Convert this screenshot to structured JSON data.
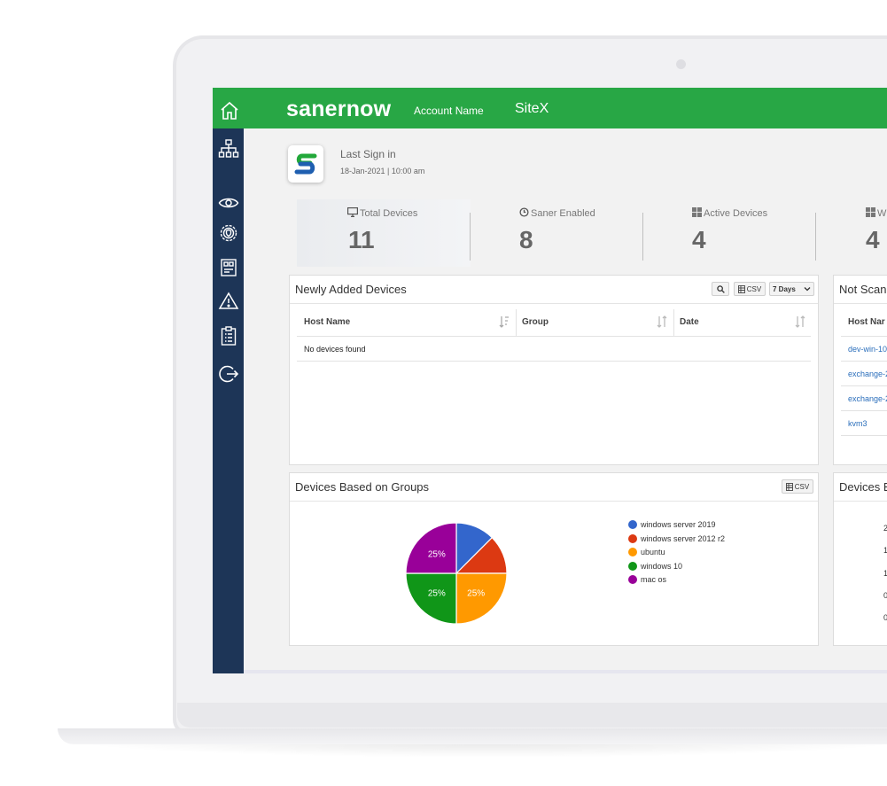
{
  "header": {
    "brand": "sanernow",
    "account_label": "Account Name",
    "account_name": "SiteX"
  },
  "sidebar": {
    "items": [
      {
        "icon": "home-icon"
      },
      {
        "icon": "network-tree-icon"
      },
      {
        "icon": "eye-icon"
      },
      {
        "icon": "gear-shield-icon"
      },
      {
        "icon": "chip-icon"
      },
      {
        "icon": "warning-icon"
      },
      {
        "icon": "clipboard-list-icon"
      },
      {
        "icon": "logout-icon"
      }
    ]
  },
  "signin": {
    "label": "Last Sign in",
    "time": "18-Jan-2021 | 10:00 am",
    "logo_letter": "S"
  },
  "stats": [
    {
      "label": "Total Devices",
      "value": "11",
      "icon": "monitor-icon"
    },
    {
      "label": "Saner Enabled",
      "value": "8",
      "icon": "power-icon"
    },
    {
      "label": "Active Devices",
      "value": "4",
      "icon": "windows-icon"
    },
    {
      "label": "Wi",
      "value": "4",
      "icon": "windows-icon"
    }
  ],
  "newly_added": {
    "title": "Newly Added Devices",
    "csv_label": "CSV",
    "range_label": "7 Days",
    "columns": [
      "Host Name",
      "Group",
      "Date"
    ],
    "empty_message": "No devices found"
  },
  "not_scanned": {
    "title": "Not Scan",
    "column": "Host Nar",
    "rows": [
      "dev-win-10",
      "exchange-2",
      "exchange-2",
      "kvm3"
    ]
  },
  "groups_chart": {
    "title": "Devices Based on Groups",
    "csv_label": "CSV"
  },
  "devices_b": {
    "title": "Devices B",
    "axis_labels": [
      "2",
      "1",
      "1",
      "0",
      "0"
    ]
  },
  "chart_data": {
    "type": "pie",
    "categories": [
      "windows server 2019",
      "windows server 2012 r2",
      "ubuntu",
      "windows 10",
      "mac os"
    ],
    "values": [
      12.5,
      12.5,
      25,
      25,
      25
    ],
    "colors": [
      "#3366cc",
      "#dc3912",
      "#ff9900",
      "#109618",
      "#990099"
    ],
    "data_labels": [
      "",
      "",
      "25%",
      "25%",
      "25%"
    ],
    "legend_position": "right"
  }
}
